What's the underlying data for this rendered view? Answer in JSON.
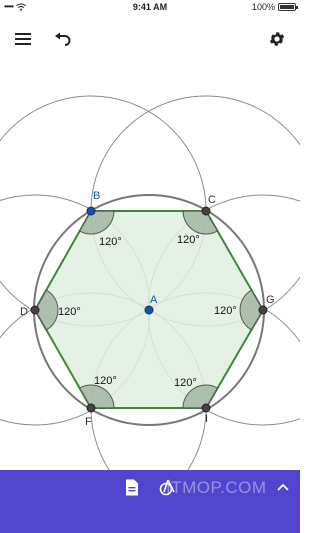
{
  "status_bar": {
    "signal": "•••••",
    "time": "9:41 AM",
    "battery": "100%"
  },
  "toolbar": {
    "menu_icon": "hamburger-menu-icon",
    "undo_icon": "undo-icon",
    "settings_icon": "gear-icon"
  },
  "construction": {
    "points": {
      "A": "A",
      "B": "B",
      "C": "C",
      "D": "D",
      "F": "F",
      "G": "G",
      "I": "I"
    },
    "angle_labels": [
      "120°",
      "120°",
      "120°",
      "120°",
      "120°",
      "120°"
    ],
    "colors": {
      "hexagon_stroke": "#3a8a3a",
      "hexagon_fill": "#e0eee0",
      "circle_stroke": "#8a8a8a",
      "blue_point": "#1d4fa8",
      "dark_point": "#444444",
      "label_blue": "#1d4fa8"
    }
  },
  "bottom_bar": {
    "color": "#5145cd",
    "algebra_icon": "document-icon",
    "tools_icon": "tools-icon",
    "expand_icon": "chevron-up-icon",
    "watermark": "ITMOP.COM"
  }
}
